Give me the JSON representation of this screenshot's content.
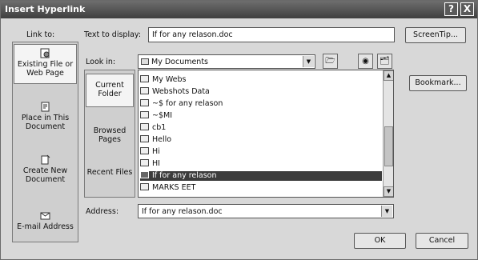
{
  "title": "Insert Hyperlink",
  "titlebar_buttons": {
    "help": "?",
    "close": "X"
  },
  "link_to": {
    "label": "Link to:",
    "items": [
      {
        "label": "Existing File or Web Page",
        "icon": "web-page-icon"
      },
      {
        "label": "Place in This Document",
        "icon": "document-place-icon"
      },
      {
        "label": "Create New Document",
        "icon": "new-document-icon"
      },
      {
        "label": "E-mail Address",
        "icon": "email-icon"
      }
    ]
  },
  "text_to_display": {
    "label": "Text to display:",
    "value": "If for any relason.doc"
  },
  "screentip_label": "ScreenTip...",
  "look_in": {
    "label": "Look in:",
    "value": "My Documents"
  },
  "side_tabs": [
    "Current Folder",
    "Browsed Pages",
    "Recent Files"
  ],
  "bookmark_label": "Bookmark...",
  "files": [
    {
      "name": "My Webs",
      "type": "folder"
    },
    {
      "name": "Webshots Data",
      "type": "folder"
    },
    {
      "name": "~$ for any relason",
      "type": "doc"
    },
    {
      "name": "~$MI",
      "type": "doc"
    },
    {
      "name": "cb1",
      "type": "doc"
    },
    {
      "name": "Hello",
      "type": "doc"
    },
    {
      "name": "Hi",
      "type": "doc"
    },
    {
      "name": "HI",
      "type": "doc"
    },
    {
      "name": "If for any relason",
      "type": "doc",
      "selected": true
    },
    {
      "name": "MARKS EET",
      "type": "doc"
    }
  ],
  "address": {
    "label": "Address:",
    "value": "If for any relason.doc"
  },
  "ok_label": "OK",
  "cancel_label": "Cancel"
}
